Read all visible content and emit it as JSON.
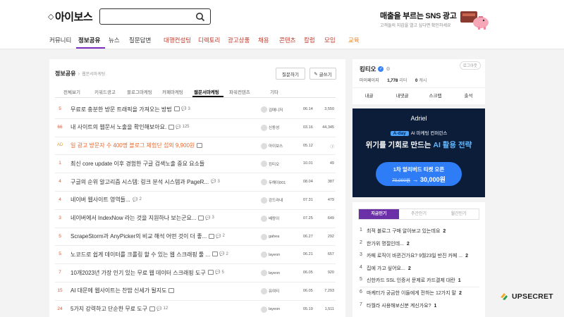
{
  "header": {
    "logo_text": "아이보스",
    "search": {
      "value": "",
      "placeholder": ""
    },
    "ad": {
      "title": "매출을 부르는 SNS 광고",
      "subtitle": "고객들의 지갑을 열고 싶다면 확인하세요"
    }
  },
  "nav": {
    "items": [
      {
        "label": "커뮤니티",
        "active": false
      },
      {
        "label": "정보공유",
        "active": true
      },
      {
        "label": "뉴스",
        "active": false
      },
      {
        "label": "질문답변",
        "active": false
      },
      {
        "label": "대행컨설팅",
        "active": false
      },
      {
        "label": "디렉토리",
        "active": false
      },
      {
        "label": "광고상품",
        "active": false
      },
      {
        "label": "채용",
        "active": false
      },
      {
        "label": "콘텐츠",
        "active": false
      },
      {
        "label": "칼럼",
        "active": false
      },
      {
        "label": "모임",
        "active": false
      },
      {
        "label": "교육",
        "active": false
      }
    ]
  },
  "board": {
    "breadcrumb": {
      "section": "정보공유",
      "separator": "›",
      "sub": "웹문서마케팅"
    },
    "question_button": "질문하기",
    "write_button": "글쓰기",
    "tabs": [
      "전체보기",
      "키워드광고",
      "블로그마케팅",
      "카페마케팅",
      "웹문서마케팅",
      "파워컨텐츠",
      "기타"
    ],
    "active_tab": 4,
    "rows": [
      {
        "num": "5",
        "title": "무료로 충분한 방문 트래픽을 가져오는 방법",
        "pic": true,
        "comments": "3",
        "author": "김매니저",
        "date": "06.14",
        "views": "3,550",
        "ad": false
      },
      {
        "num": "66",
        "title": "내 사이트의 웹문서 노출을 확인해보아요.",
        "pic": true,
        "comments": "125",
        "author": "신동성",
        "date": "03.16",
        "views": "44,345",
        "ad": false
      },
      {
        "num": "AD",
        "title": "일 광고 방문자 수 400명 블로그 체험단 섭외 9,900원",
        "pic": true,
        "comments": "",
        "author": "아이보스",
        "date": "05.12",
        "views": "ⓘ",
        "ad": true
      },
      {
        "num": "1",
        "title": "최신 core update 이후 경험한 구글 검색노출 중요 요소들",
        "pic": false,
        "comments": "",
        "author": "킹티오",
        "date": "10.01",
        "views": "49",
        "ad": false
      },
      {
        "num": "4",
        "title": "구글의 순위 알고리즘 시스템: 링크 분석 시스템과 PageR...",
        "pic": false,
        "comments": "3",
        "author": "두해이001",
        "date": "08.04",
        "views": "387",
        "ad": false
      },
      {
        "num": "4",
        "title": "네이버 웹사이트 영역들...",
        "pic": false,
        "comments": "2",
        "author": "강드라내",
        "date": "07.31",
        "views": "479",
        "ad": false
      },
      {
        "num": "3",
        "title": "네이버에서 IndexNow 라는 것을 지원하나 보는군요...",
        "pic": true,
        "comments": "3",
        "author": "베랑이",
        "date": "07.25",
        "views": "649",
        "ad": false
      },
      {
        "num": "5",
        "title": "ScrapeStorm과 AnyPicker의 비교 해석 어떤 것이 더 좋...",
        "pic": true,
        "comments": "2",
        "author": "gahea",
        "date": "06.27",
        "views": "292",
        "ad": false
      },
      {
        "num": "5",
        "title": "노코드로 쉽게 데이터를 크롤링 할 수 있는 웹 스크래핑 툴 ...",
        "pic": true,
        "comments": "2",
        "author": "layeon",
        "date": "06.21",
        "views": "657",
        "ad": false
      },
      {
        "num": "7",
        "title": "10개2023년 가장 인기 있는 무료 웹 데이터 스크래핑 도구",
        "pic": true,
        "comments": "5",
        "author": "layeon",
        "date": "06.05",
        "views": "920",
        "ad": false
      },
      {
        "num": "15",
        "title": "AI 대문에 웹사이트는 찬밥 신세가 될지도",
        "pic": true,
        "comments": "",
        "author": "유여티",
        "date": "06.05",
        "views": "7,293",
        "ad": false
      },
      {
        "num": "24",
        "title": "5가지 강력하고 단순한 무료 도구",
        "pic": true,
        "comments": "12",
        "author": "layeon",
        "date": "05.19",
        "views": "1,511",
        "ad": false
      }
    ]
  },
  "profile": {
    "name": "킹티오",
    "logout": "로그아웃",
    "mypage": "마이페이지",
    "points": "1,778",
    "points_label": "리터",
    "cash": "0",
    "cash_label": "캐시",
    "actions": [
      "내글",
      "내댓글",
      "스크랩",
      "출석"
    ]
  },
  "banner": {
    "brand": "Adriel",
    "chip": "A-day",
    "tagline": "AI 마케팅 컨퍼런스",
    "headline_a": "위기를 기회로 만드는 ",
    "headline_b": "AI 활용 전략",
    "pill_line1": "1차 얼리버드 티켓 오픈",
    "old_price": "70,000원",
    "arrow": "→",
    "new_price": "30,000원"
  },
  "popular": {
    "tabs": [
      "지금인기",
      "주간인기",
      "월간인기"
    ],
    "active_tab": 0,
    "items": [
      {
        "n": "1",
        "t": "최적 블로그 구매 알아보고 있는데요",
        "c": "2"
      },
      {
        "n": "2",
        "t": "한가위 명절인데...",
        "c": "2"
      },
      {
        "n": "3",
        "t": "카페 로직이 바뀐건가요? 9월23일 반진 카페 ...",
        "c": "2"
      },
      {
        "n": "4",
        "t": "집에 가고 싶어요...",
        "c": "2"
      },
      {
        "n": "5",
        "t": "신한카드 SSL 인증서 문제로 카드결제 대란",
        "c": "1"
      },
      {
        "n": "6",
        "t": "마케터가 궁금한 이들에게 전하는 12가지 말",
        "c": "2"
      },
      {
        "n": "7",
        "t": "타월라 사용해보신분 계신가요?",
        "c": "1"
      }
    ]
  },
  "watermark": {
    "text": "UPSECRET"
  },
  "colors": {
    "accent": "#7b2fbf",
    "rank": "#e8542e",
    "ad_title": "#e8682e",
    "banner_bg": "#0c1d3a",
    "banner_pill": "#2f7df6"
  }
}
